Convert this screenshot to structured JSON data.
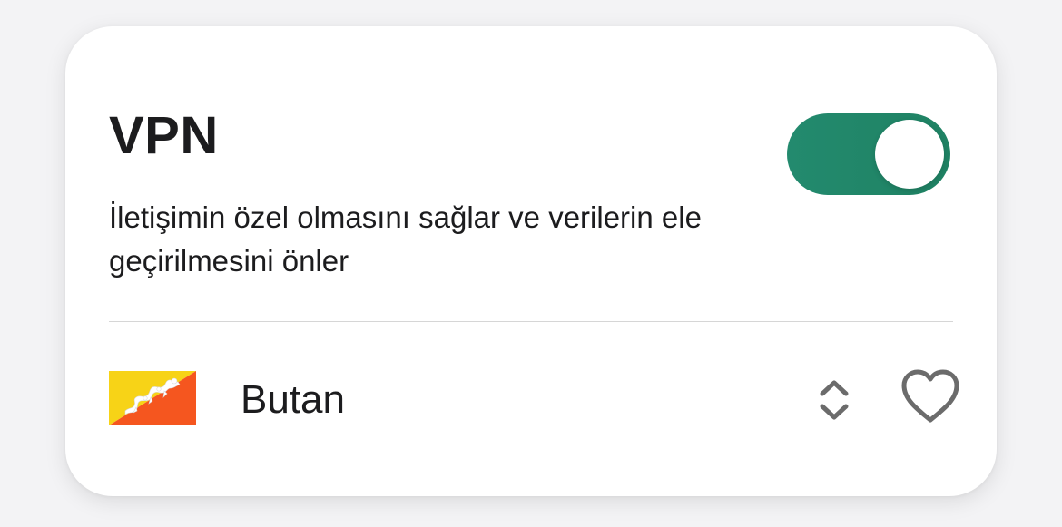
{
  "vpn": {
    "title": "VPN",
    "description": "İletişimin özel olmasını sağlar ve verilerin ele geçirilmesini önler",
    "enabled": true,
    "accent_color": "#1f8263"
  },
  "location": {
    "country": "Butan",
    "flag_icon": "bhutan-flag-icon",
    "selector_icon": "chevrons-up-down-icon",
    "favorite_icon": "heart-outline-icon",
    "favorite": false
  }
}
